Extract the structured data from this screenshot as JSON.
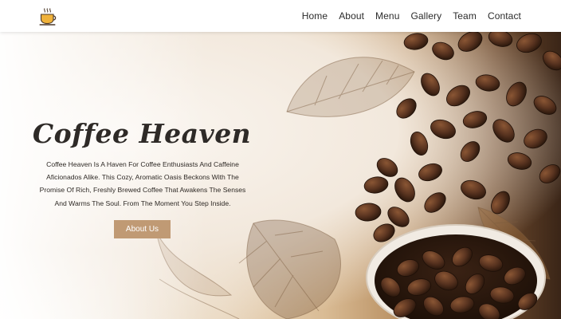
{
  "brand": {
    "logo_icon": "coffee-cup-icon",
    "accent": "#c09a74"
  },
  "nav": {
    "items": [
      {
        "label": "Home"
      },
      {
        "label": "About"
      },
      {
        "label": "Menu"
      },
      {
        "label": "Gallery"
      },
      {
        "label": "Team"
      },
      {
        "label": "Contact"
      }
    ]
  },
  "hero": {
    "title": "Coffee Heaven",
    "description": "Coffee Heaven Is A Haven For Coffee Enthusiasts And Caffeine Aficionados Alike. This Cozy, Aromatic Oasis Beckons With The Promise Of Rich, Freshly Brewed Coffee That Awakens The Senses And Warms The Soul. From The Moment You Step Inside.",
    "button_label": "About Us",
    "background_image": "coffee-beans-and-leaves"
  }
}
